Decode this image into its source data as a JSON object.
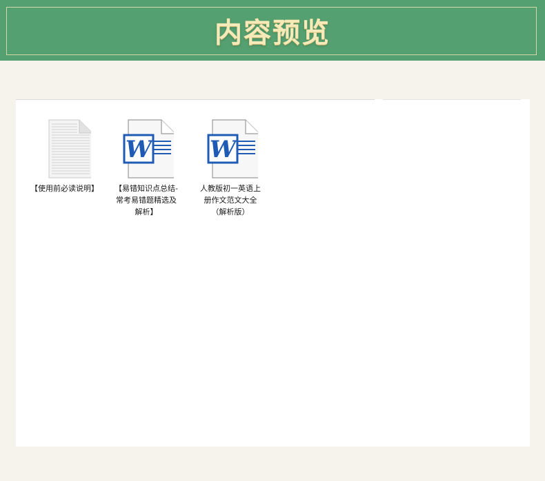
{
  "header": {
    "title": "内容预览"
  },
  "colors": {
    "header_bg": "#55a070",
    "title_text": "#f7eab9",
    "page_bg": "#f6f3ec",
    "word_blue": "#1f5bb4"
  },
  "files": [
    {
      "label": "【使用前必读说明】",
      "icon": "text-document-icon"
    },
    {
      "label": "【易错知识点总结-常考易错题精选及解析】",
      "icon": "word-document-icon"
    },
    {
      "label": "人教版初一英语上册作文范文大全（解析版）",
      "icon": "word-document-icon"
    }
  ]
}
